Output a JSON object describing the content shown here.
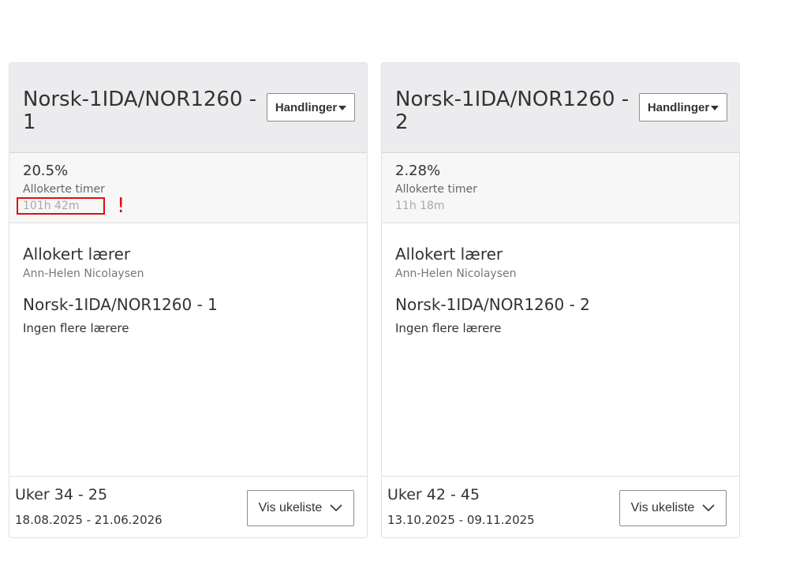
{
  "cards": [
    {
      "title": "Norsk-1IDA/NOR1260 - 1",
      "actions_label": "Handlinger",
      "percent": "20.5%",
      "allocated_hours_label": "Allokerte timer",
      "hours": "101h 42m",
      "warning": "!",
      "teacher_heading": "Allokert lærer",
      "teacher_name": "Ann-Helen Nicolaysen",
      "group_name": "Norsk-1IDA/NOR1260 - 1",
      "no_more_teachers": "Ingen flere lærere",
      "weeks": "Uker 34 - 25",
      "dates": "18.08.2025 - 21.06.2026",
      "week_list_label": "Vis ukeliste"
    },
    {
      "title": "Norsk-1IDA/NOR1260 - 2",
      "actions_label": "Handlinger",
      "percent": "2.28%",
      "allocated_hours_label": "Allokerte timer",
      "hours": "11h 18m",
      "teacher_heading": "Allokert lærer",
      "teacher_name": "Ann-Helen Nicolaysen",
      "group_name": "Norsk-1IDA/NOR1260 - 2",
      "no_more_teachers": "Ingen flere lærere",
      "weeks": "Uker 42 - 45",
      "dates": "13.10.2025 - 09.11.2025",
      "week_list_label": "Vis ukeliste"
    }
  ],
  "colors": {
    "header_bg": "#ececee",
    "stats_bg": "#f7f7f7",
    "warning": "#e01010"
  }
}
